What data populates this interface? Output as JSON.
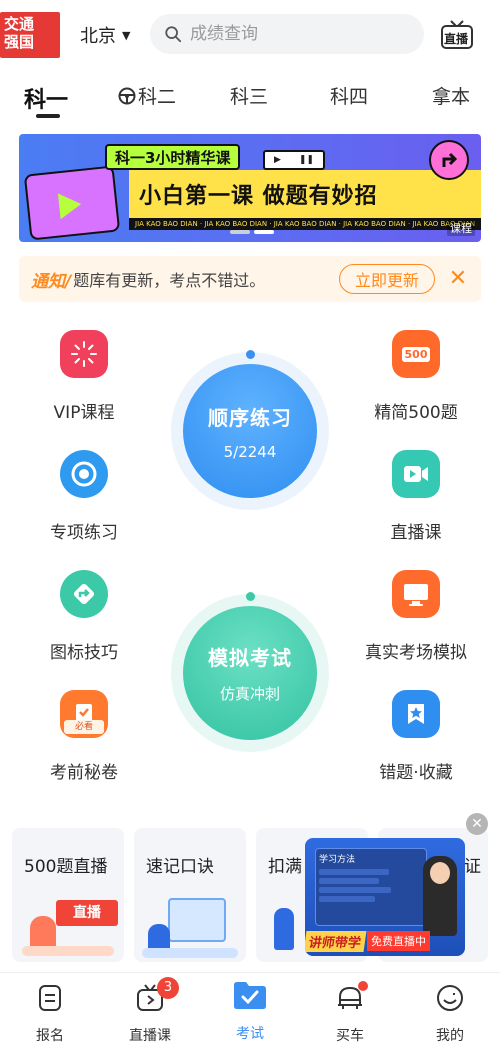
{
  "header": {
    "logo_line1": "交通",
    "logo_line2": "强国",
    "city": "北京",
    "search_placeholder": "成绩查询",
    "live_icon_label": "直播"
  },
  "tabs": [
    {
      "label": "科一",
      "active": true
    },
    {
      "label": "科二",
      "icon": "steering-wheel-icon"
    },
    {
      "label": "科三"
    },
    {
      "label": "科四"
    },
    {
      "label": "拿本"
    }
  ],
  "banner": {
    "pill": "科一3小时精华课",
    "headline": "小白第一课 做题有妙招",
    "strip_text": "JIA KAO BAO DIAN · JIA KAO BAO DIAN · JIA KAO BAO DIAN · JIA KAO BAO DIAN · JIA KAO BAO DIAN",
    "tag": "课程",
    "active_dot": 1
  },
  "notice": {
    "tag": "通知/",
    "text": "题库有更新，考点不错过。",
    "button": "立即更新"
  },
  "features_left": [
    {
      "label": "VIP课程",
      "icon": "vip-course-icon",
      "color": "#f0405b"
    },
    {
      "label": "专项练习",
      "icon": "target-icon",
      "color": "#2e9bf0"
    },
    {
      "label": "图标技巧",
      "icon": "road-sign-icon",
      "color": "#3cc9a8"
    },
    {
      "label": "考前秘卷",
      "icon": "secret-paper-icon",
      "color": "#ff7a2e",
      "sub": "必看"
    }
  ],
  "features_right": [
    {
      "label": "精简500题",
      "icon": "500-questions-icon",
      "color": "#ff6a2b",
      "sub": "500"
    },
    {
      "label": "直播课",
      "icon": "live-video-icon",
      "color": "#35c9b4"
    },
    {
      "label": "真实考场模拟",
      "icon": "monitor-icon",
      "color": "#ff6b2c"
    },
    {
      "label": "错题·收藏",
      "icon": "star-bookmark-icon",
      "color": "#2f8ff0"
    }
  ],
  "sequential_practice": {
    "title": "顺序练习",
    "progress": "5/2244"
  },
  "mock_exam": {
    "title": "模拟考试",
    "subtitle": "仿真冲刺"
  },
  "cards": [
    {
      "title": "500题直播",
      "art_text": "直播"
    },
    {
      "title": "速记口诀"
    },
    {
      "title": "扣满"
    },
    {
      "title": "证"
    }
  ],
  "float_ad": {
    "board_title": "学习方法",
    "ribbon": "讲师带学",
    "cta": "免费直播中"
  },
  "bottom_nav": [
    {
      "label": "报名",
      "icon": "signup-icon"
    },
    {
      "label": "直播课",
      "icon": "tv-play-icon",
      "badge": "3"
    },
    {
      "label": "考试",
      "icon": "exam-folder-icon",
      "active": true
    },
    {
      "label": "买车",
      "icon": "car-icon",
      "dot": true
    },
    {
      "label": "我的",
      "icon": "smile-face-icon"
    }
  ],
  "colors": {
    "accent_blue": "#3b8ff0",
    "notice_orange": "#ff8a1f",
    "mock_green": "#3cc9a8"
  }
}
